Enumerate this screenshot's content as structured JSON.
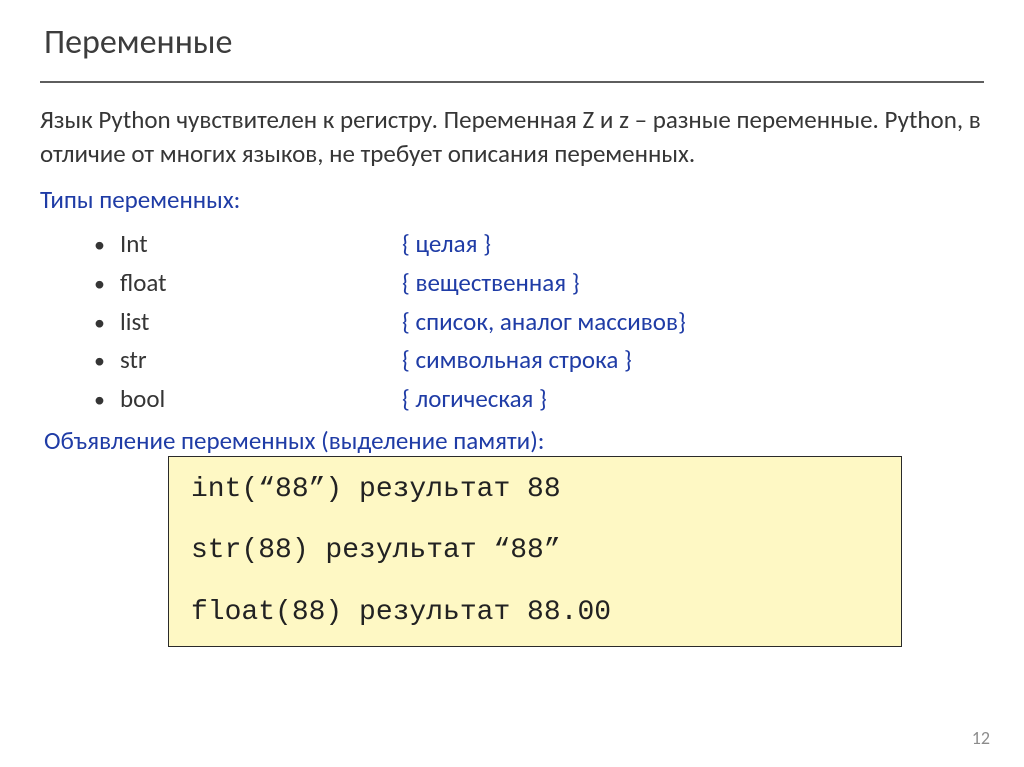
{
  "title": "Переменные",
  "paragraph": "Язык Python чувствителен к регистру. Переменная Z  и z – разные переменные. Python, в отличие от многих языков, не требует описания переменных.",
  "types_heading": "Типы переменных:",
  "types": [
    {
      "name": "Int",
      "desc": "{ целая }"
    },
    {
      "name": "float",
      "desc": "{ вещественная }"
    },
    {
      "name": "list",
      "desc": "{ список, аналог массивов}"
    },
    {
      "name": "str",
      "desc": "{ символьная строка }"
    },
    {
      "name": "bool",
      "desc": "{ логическая }"
    }
  ],
  "declaration_heading": "Объявление переменных (выделение памяти):",
  "code": {
    "line1": "int(“88”) результат 88",
    "line2": "str(88) результат “88”",
    "line3": "float(88) результат 88.00"
  },
  "page_number": "12"
}
